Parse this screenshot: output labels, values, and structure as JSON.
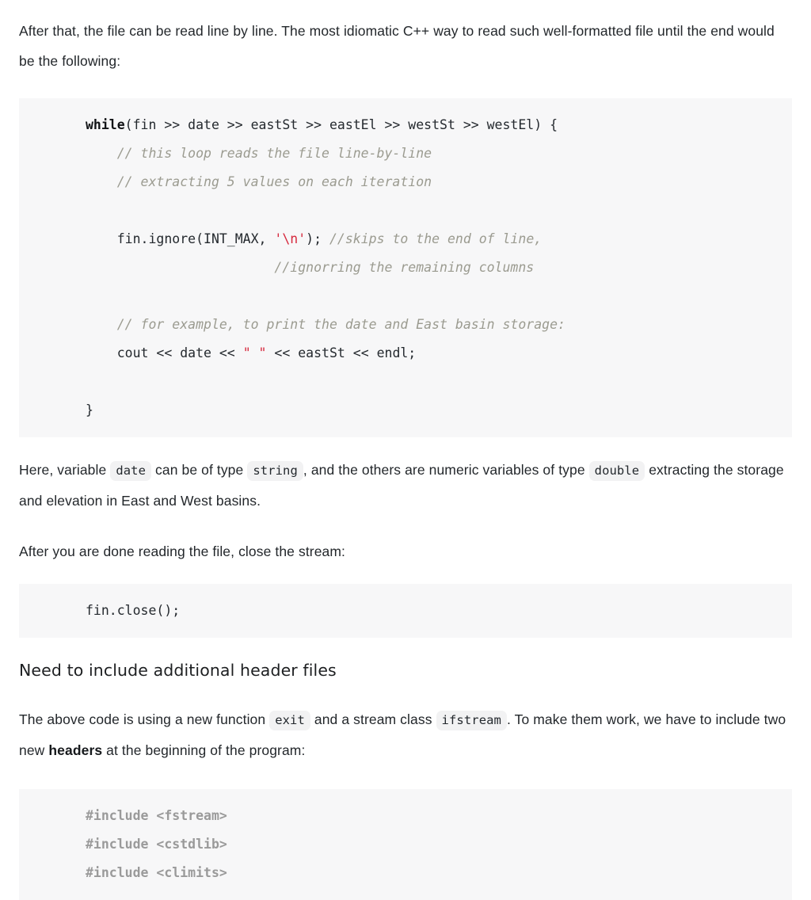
{
  "document": {
    "type": "tutorial-article",
    "topic": "C++ file reading with ifstream"
  },
  "colors": {
    "page_background": "#ffffff",
    "code_block_background": "#f7f7f8",
    "inline_code_background": "#f2f2f3",
    "body_text": "#23272b",
    "code_text": "#24292e",
    "comment": "#9b9b90",
    "string_literal": "#d6293e",
    "preprocessor": "#9a9a9a"
  },
  "paragraph_1": {
    "line_1": "After that, the file can be read line by line. The most idiomatic C++ way to read such well-formatted",
    "line_2": "file until the end would be the following:",
    "full": "After that, the file can be read line by line. The most idiomatic C++ way to read such well-formatted file until the end would be the following:"
  },
  "code_block_1": {
    "language": "cpp",
    "lines": [
      {
        "id": "while-header",
        "tokens": [
          {
            "text": "while",
            "style": "keyword"
          },
          {
            "text": "(fin >> date >> eastSt >> eastEl >> westSt >> westEl) {",
            "style": "plain"
          }
        ],
        "text": "while(fin >> date >> eastSt >> eastEl >> westSt >> westEl) {"
      },
      {
        "id": "comment-loop-reads",
        "tokens": [
          {
            "text": "    // this loop reads the file line-by-line",
            "style": "comment"
          }
        ],
        "text": "    // this loop reads the file line-by-line"
      },
      {
        "id": "comment-extracting",
        "tokens": [
          {
            "text": "    // extracting 5 values on each iteration",
            "style": "comment"
          }
        ],
        "text": "    // extracting 5 values on each iteration"
      },
      {
        "id": "blank-1",
        "tokens": [],
        "text": ""
      },
      {
        "id": "fin-ignore",
        "tokens": [
          {
            "text": "    fin.ignore(INT_MAX, ",
            "style": "plain"
          },
          {
            "text": "'\\n'",
            "style": "string"
          },
          {
            "text": "); ",
            "style": "plain"
          },
          {
            "text": "//skips to the end of line,",
            "style": "comment"
          }
        ],
        "text": "    fin.ignore(INT_MAX, '\\n'); //skips to the end of line,"
      },
      {
        "id": "comment-ignorring",
        "tokens": [
          {
            "text": "                        //ignorring the remaining columns",
            "style": "comment"
          }
        ],
        "text": "                        //ignorring the remaining columns"
      },
      {
        "id": "blank-2",
        "tokens": [],
        "text": ""
      },
      {
        "id": "comment-for-example",
        "tokens": [
          {
            "text": "    // for example, to print the date and East basin storage:",
            "style": "comment"
          }
        ],
        "text": "    // for example, to print the date and East basin storage:"
      },
      {
        "id": "cout-line",
        "tokens": [
          {
            "text": "    cout << date << ",
            "style": "plain"
          },
          {
            "text": "\" \"",
            "style": "string"
          },
          {
            "text": " << eastSt << endl;",
            "style": "plain"
          }
        ],
        "text": "    cout << date << \" \" << eastSt << endl;"
      },
      {
        "id": "blank-3",
        "tokens": [],
        "text": ""
      },
      {
        "id": "close-brace",
        "tokens": [
          {
            "text": "}",
            "style": "plain"
          }
        ],
        "text": "}"
      }
    ]
  },
  "paragraph_2": {
    "segments": [
      {
        "type": "text",
        "text": "Here, variable "
      },
      {
        "type": "code",
        "text": "date"
      },
      {
        "type": "text",
        "text": " can be of type "
      },
      {
        "type": "code",
        "text": "string"
      },
      {
        "type": "text",
        "text": " , and the others are numeric variables of type "
      },
      {
        "type": "code",
        "text": "double"
      },
      {
        "type": "text",
        "text": " extracting the storage and elevation in East and West basins."
      }
    ],
    "text_1": "Here, variable ",
    "code_1": "date",
    "text_2": " can be of type ",
    "code_2": "string",
    "text_3": ", and the others are numeric variables of type",
    "code_3": "double",
    "text_4": "extracting the storage and elevation in East and West basins."
  },
  "paragraph_3": {
    "text": "After you are done reading the file, close the stream:"
  },
  "code_block_2": {
    "language": "cpp",
    "lines": [
      {
        "id": "fin-close",
        "tokens": [
          {
            "text": "fin.close();",
            "style": "plain"
          }
        ],
        "text": "fin.close();"
      }
    ]
  },
  "heading_1": {
    "text": "Need to include additional header files",
    "level": 3
  },
  "paragraph_4": {
    "segments": [
      {
        "type": "text",
        "text": "The above code is using a new function "
      },
      {
        "type": "code",
        "text": "exit"
      },
      {
        "type": "text",
        "text": " and a stream class "
      },
      {
        "type": "code",
        "text": "ifstream"
      },
      {
        "type": "text",
        "text": " . To make them work, we have to include two new "
      },
      {
        "type": "strong",
        "text": "headers"
      },
      {
        "type": "text",
        "text": " at the beginning of the program:"
      }
    ],
    "text_1": "The above code is using a new function ",
    "code_1": "exit",
    "text_2": " and a stream class ",
    "code_2": "ifstream",
    "text_3": ". To make them work, we have to include two new ",
    "strong_1": "headers",
    "text_4": " at the beginning of the program:"
  },
  "code_block_3": {
    "language": "cpp",
    "lines": [
      {
        "id": "include-fstream",
        "tokens": [
          {
            "text": "#include <fstream>",
            "style": "preprocessor"
          }
        ],
        "text": "#include <fstream>"
      },
      {
        "id": "include-cstdlib",
        "tokens": [
          {
            "text": "#include <cstdlib>",
            "style": "preprocessor"
          }
        ],
        "text": "#include <cstdlib>"
      },
      {
        "id": "include-climits",
        "tokens": [
          {
            "text": "#include <climits>",
            "style": "preprocessor"
          }
        ],
        "text": "#include <climits>"
      }
    ]
  }
}
